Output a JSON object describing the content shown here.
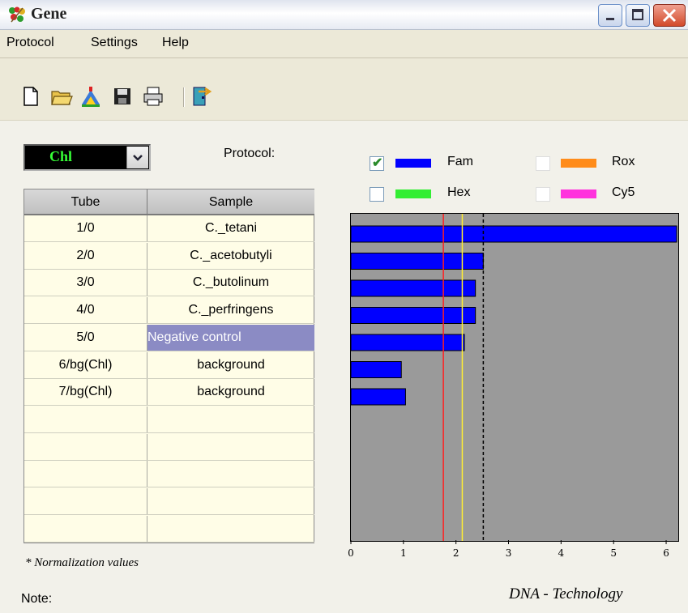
{
  "window": {
    "title": "Gene"
  },
  "menu": {
    "items": [
      "Protocol",
      "Settings",
      "Help"
    ]
  },
  "toolbar": {
    "icons": [
      "new-file-icon",
      "open-folder-icon",
      "chart-wizard-icon",
      "save-disk-icon",
      "print-icon",
      "exit-door-icon"
    ]
  },
  "channel_selector": {
    "value": "Chl",
    "text_color": "#36ff36"
  },
  "protocol": {
    "label": "Protocol:"
  },
  "table": {
    "headers": [
      "Tube",
      "Sample"
    ],
    "rows": [
      {
        "tube": "1/0",
        "sample": "C._tetani"
      },
      {
        "tube": "2/0",
        "sample": "C._acetobutyli"
      },
      {
        "tube": "3/0",
        "sample": "C._butolinum"
      },
      {
        "tube": "4/0",
        "sample": "C._perfringens"
      },
      {
        "tube": "5/0",
        "sample": "Negative control"
      },
      {
        "tube": "6/bg(Chl)",
        "sample": "background"
      },
      {
        "tube": "7/bg(Chl)",
        "sample": "background"
      }
    ],
    "empty_rows": 5,
    "selected_row_index": 4,
    "selected_color": "#8b8bc4"
  },
  "legend": [
    {
      "label": "Fam",
      "checked": true,
      "color": "#0000ff"
    },
    {
      "label": "Hex",
      "checked": false,
      "color": "#33ee33"
    },
    {
      "label": "Rox",
      "checked": false,
      "color": "#ff8c1a"
    },
    {
      "label": "Cy5",
      "checked": false,
      "color": "#ff33dd"
    }
  ],
  "chart_data": {
    "type": "bar",
    "orientation": "horizontal",
    "categories": [
      "1/0",
      "2/0",
      "3/0",
      "4/0",
      "5/0",
      "6/bg(Chl)",
      "7/bg(Chl)"
    ],
    "series": [
      {
        "name": "Fam",
        "values": [
          6.2,
          2.52,
          2.37,
          2.37,
          2.16,
          0.96,
          1.04
        ]
      }
    ],
    "xlim": [
      0,
      6.2
    ],
    "xticks": [
      "0",
      "1",
      "2",
      "3",
      "4",
      "5",
      "6"
    ],
    "reference_lines": [
      {
        "value": 1.76,
        "color": "#ff2020",
        "style": "solid"
      },
      {
        "value": 2.12,
        "color": "#ffee33",
        "style": "solid"
      },
      {
        "value": 2.52,
        "color": "#000000",
        "style": "dashed"
      }
    ],
    "background": "#9a9a9a",
    "bar_color": "#0000ff"
  },
  "footer": {
    "normalization_note": "* Normalization values",
    "note_label": "Note:",
    "brand": "DNA - Technology"
  }
}
